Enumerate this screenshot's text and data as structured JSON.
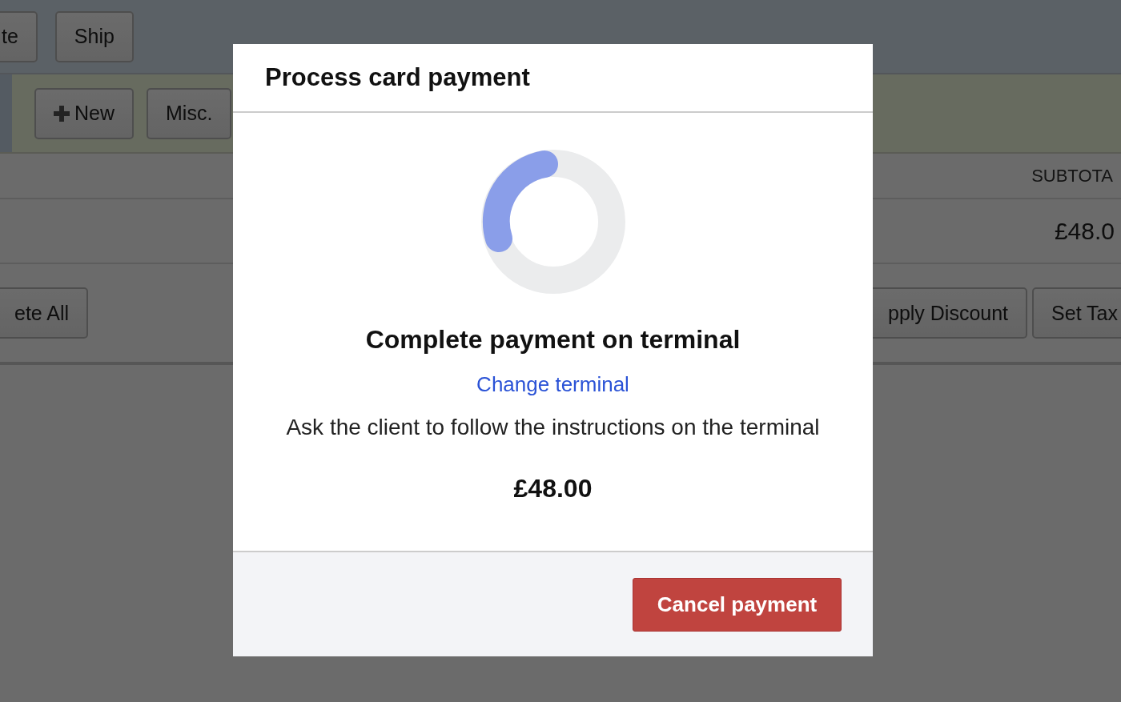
{
  "background": {
    "toolbar_buttons": [
      "te",
      "Ship"
    ],
    "action_buttons": [
      {
        "label": "New",
        "kind": "add"
      },
      {
        "label": "Misc.",
        "kind": "plain"
      }
    ],
    "column_header": "SUBTOTA",
    "subtotal": "£48.0",
    "footer_buttons_left": [
      "ete All"
    ],
    "footer_buttons_right": [
      "pply Discount",
      "Set Tax"
    ]
  },
  "dialog": {
    "title": "Process card payment",
    "heading": "Complete payment on terminal",
    "link": "Change terminal",
    "instruction": "Ask the client to follow the instructions on the terminal",
    "amount": "£48.00",
    "cancel_button": "Cancel payment"
  }
}
